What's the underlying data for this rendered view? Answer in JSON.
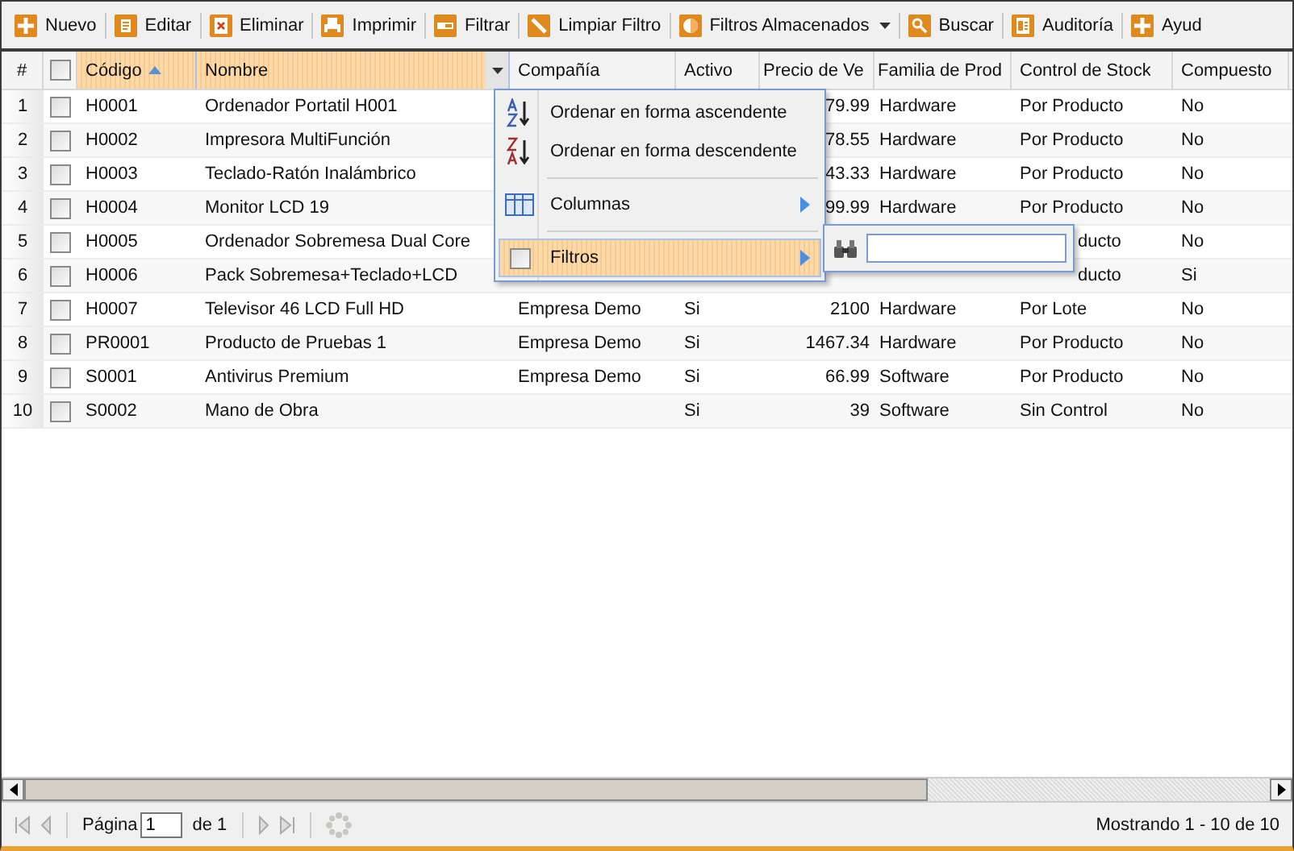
{
  "toolbar": [
    {
      "kind": "add",
      "label": "Nuevo",
      "dropdown": false
    },
    {
      "kind": "edit",
      "label": "Editar",
      "dropdown": false
    },
    {
      "kind": "delete",
      "label": "Eliminar",
      "dropdown": false
    },
    {
      "kind": "print",
      "label": "Imprimir",
      "dropdown": false
    },
    {
      "kind": "filter",
      "label": "Filtrar",
      "dropdown": false
    },
    {
      "kind": "clear",
      "label": "Limpiar Filtro",
      "dropdown": false
    },
    {
      "kind": "stored",
      "label": "Filtros Almacenados",
      "dropdown": true
    },
    {
      "kind": "search",
      "label": "Buscar",
      "dropdown": false
    },
    {
      "kind": "audit",
      "label": "Auditoría",
      "dropdown": false
    },
    {
      "kind": "add",
      "label": "Ayud",
      "dropdown": false
    }
  ],
  "table": {
    "number_header": "#",
    "all_checked": false,
    "columns": [
      {
        "label": "Código",
        "sorted": true,
        "highlighted": true
      },
      {
        "label": "Nombre",
        "sorted": false,
        "highlighted": true
      },
      {
        "label": "Compañía",
        "sorted": false,
        "highlighted": false
      },
      {
        "label": "Activo",
        "sorted": false,
        "highlighted": false
      },
      {
        "label": "Precio de Ve",
        "sorted": false,
        "highlighted": false
      },
      {
        "label": "Familia de Prod",
        "sorted": false,
        "highlighted": false
      },
      {
        "label": "Control de Stock",
        "sorted": false,
        "highlighted": false
      },
      {
        "label": "Compuesto",
        "sorted": false,
        "highlighted": false
      }
    ],
    "rows": [
      {
        "number": "1",
        "checked": false,
        "cells": [
          "H0001",
          "Ordenador Portatil H001",
          null,
          null,
          "79.99",
          "Hardware",
          "Por Producto",
          "No"
        ]
      },
      {
        "number": "2",
        "checked": false,
        "cells": [
          "H0002",
          "Impresora MultiFunción",
          null,
          null,
          "78.55",
          "Hardware",
          "Por Producto",
          "No"
        ]
      },
      {
        "number": "3",
        "checked": false,
        "cells": [
          "H0003",
          "Teclado-Ratón Inalámbrico",
          null,
          null,
          "43.33",
          "Hardware",
          "Por Producto",
          "No"
        ]
      },
      {
        "number": "4",
        "checked": false,
        "cells": [
          "H0004",
          "Monitor LCD 19",
          null,
          null,
          "99.99",
          "Hardware",
          "Por Producto",
          "No"
        ]
      },
      {
        "number": "5",
        "checked": false,
        "cells": [
          "H0005",
          "Ordenador Sobremesa Dual Core",
          null,
          null,
          null,
          null,
          {
            "text": "ducto",
            "clipped": true
          },
          "No"
        ]
      },
      {
        "number": "6",
        "checked": false,
        "cells": [
          "H0006",
          "Pack Sobremesa+Teclado+LCD",
          null,
          null,
          null,
          null,
          {
            "text": "ducto",
            "clipped": true
          },
          "Si"
        ]
      },
      {
        "number": "7",
        "checked": false,
        "cells": [
          "H0007",
          "Televisor 46 LCD Full HD",
          "Empresa Demo",
          "Si",
          "2100",
          "Hardware",
          "Por Lote",
          "No"
        ]
      },
      {
        "number": "8",
        "checked": false,
        "cells": [
          "PR0001",
          "Producto de Pruebas 1",
          "Empresa Demo",
          "Si",
          "1467.34",
          "Hardware",
          "Por Producto",
          "No"
        ]
      },
      {
        "number": "9",
        "checked": false,
        "cells": [
          "S0001",
          "Antivirus Premium",
          "Empresa Demo",
          "Si",
          "66.99",
          "Software",
          "Por Producto",
          "No"
        ]
      },
      {
        "number": "10",
        "checked": false,
        "cells": [
          "S0002",
          "Mano de Obra",
          null,
          "Si",
          "39",
          "Software",
          "Sin Control",
          "No"
        ]
      }
    ]
  },
  "column_menu": {
    "items": [
      {
        "kind": "sort-asc",
        "label": "Ordenar en forma ascendente",
        "submenu": false,
        "checked": false,
        "selected": false
      },
      {
        "kind": "sort-desc",
        "label": "Ordenar en forma descendente",
        "submenu": false,
        "checked": false,
        "selected": false
      },
      {
        "kind": "columns",
        "label": "Columnas",
        "submenu": true,
        "checked": false,
        "selected": false
      },
      {
        "kind": "filters",
        "label": "Filtros",
        "submenu": true,
        "checked": false,
        "selected": true
      }
    ]
  },
  "pager": {
    "page_label": "Página",
    "page_value": "1",
    "of_label": "de 1",
    "status": "Mostrando 1 - 10 de 10"
  }
}
